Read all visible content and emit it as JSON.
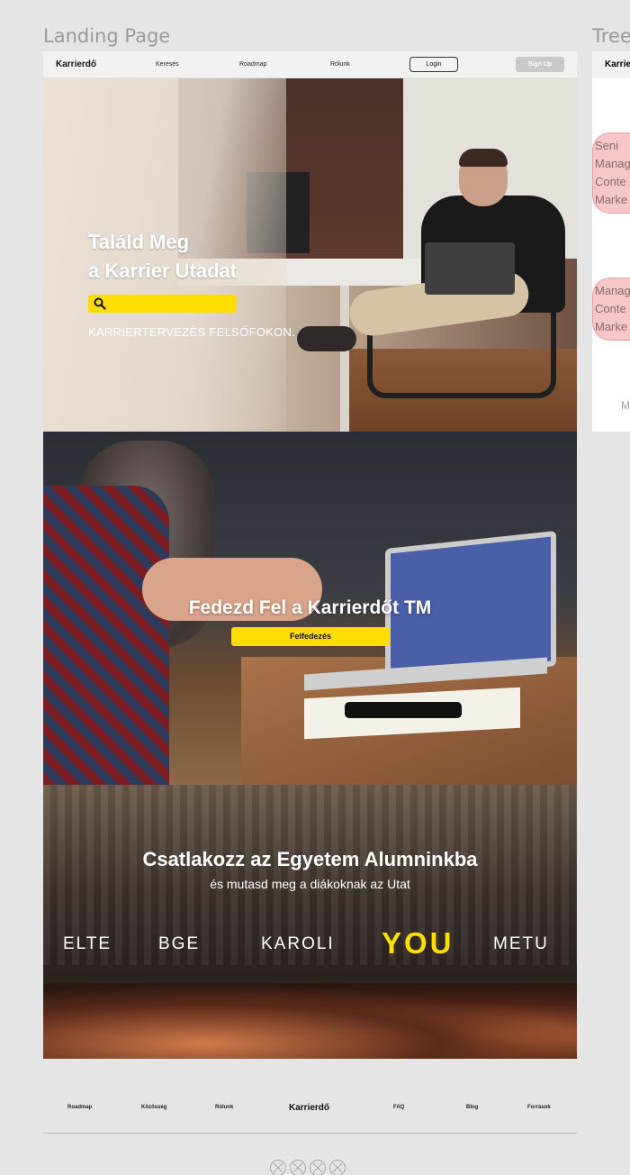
{
  "frames": {
    "main_label": "Landing Page",
    "tree_label": "Tree"
  },
  "navbar": {
    "logo": "Karrierdő",
    "links": [
      "Keresés",
      "Roadmap",
      "Rólunk"
    ],
    "login": "Login",
    "signup": "Sign Up"
  },
  "hero1": {
    "title_line1": "Találd Meg",
    "title_line2": "a Karrier Utadat",
    "search_placeholder": "",
    "tagline": "KARRIERTERVEZÉS FELSŐFOKON."
  },
  "hero2": {
    "title": "Fedezd Fel a Karrierdőt TM",
    "cta": "Felfedezés"
  },
  "hero3": {
    "title": "Csatlakozz az Egyetem Alumninkba",
    "subtitle": "és mutasd meg a diákoknak az Utat",
    "universities": [
      "ELTE",
      "BGE",
      "KAROLI",
      "YOU",
      "METU"
    ]
  },
  "footer": {
    "links_left": [
      "Roadmap",
      "Közösség",
      "Rólunk"
    ],
    "logo": "Karrierdő",
    "links_right": [
      "FAQ",
      "Blog",
      "Források"
    ]
  },
  "tree": {
    "nav_logo": "Karrier",
    "node1": [
      "Seni",
      "Manag",
      "Conte",
      "Marke"
    ],
    "node2": [
      "Manag",
      "Conte",
      "Marke"
    ],
    "bottom_char": "M"
  },
  "colors": {
    "accent": "#ffdd00",
    "page_bg": "#e5e5e5",
    "node_fill": "#f7c7c7"
  }
}
